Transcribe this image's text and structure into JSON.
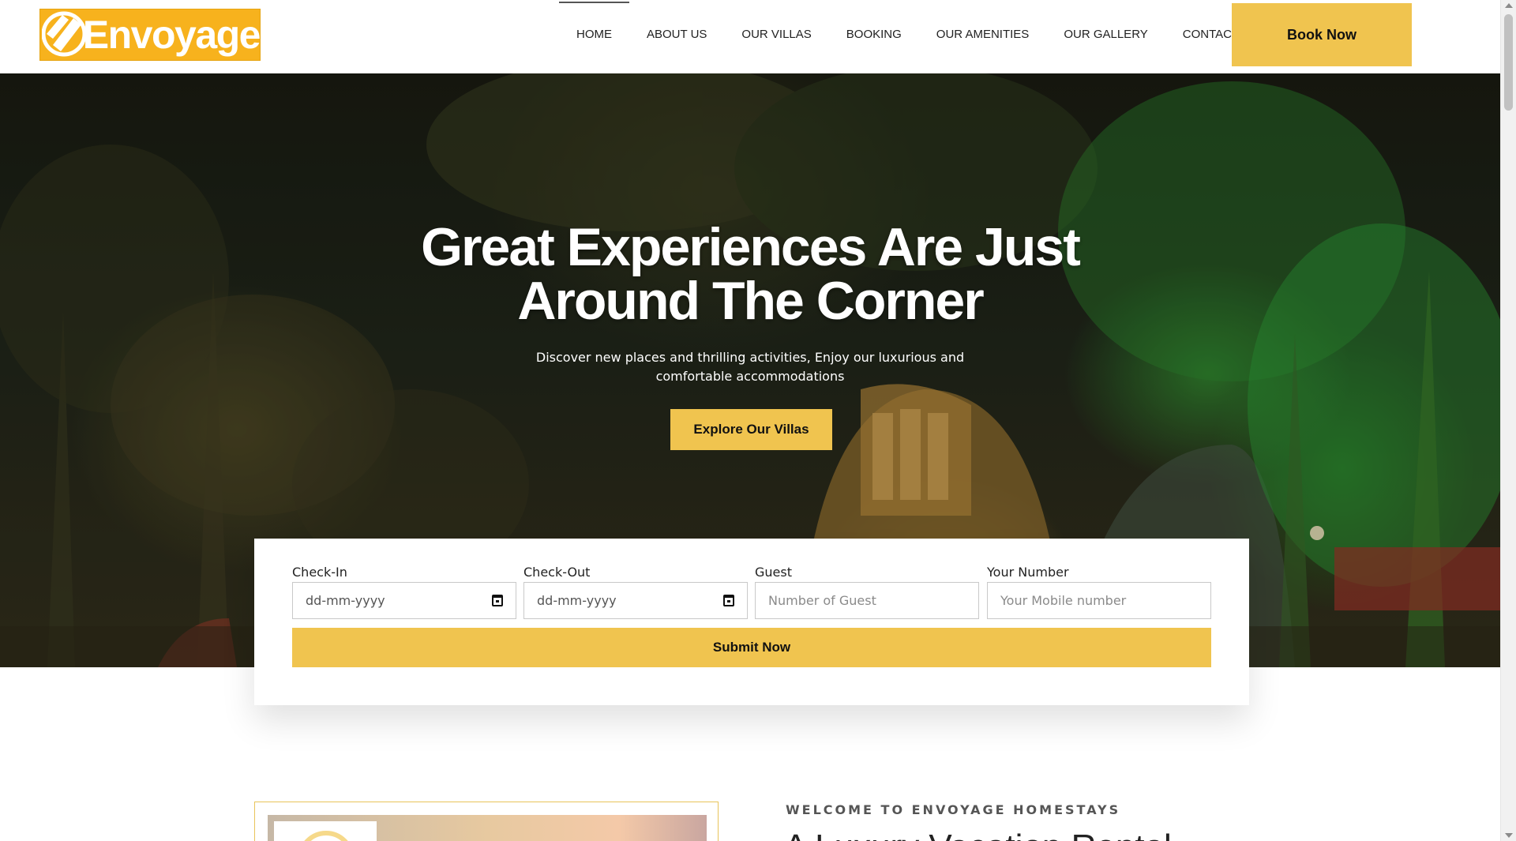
{
  "header": {
    "logo_text": "Envoyage",
    "nav": [
      {
        "label": "HOME",
        "active": true
      },
      {
        "label": "ABOUT US"
      },
      {
        "label": "OUR VILLAS"
      },
      {
        "label": "BOOKING"
      },
      {
        "label": "OUR AMENITIES"
      },
      {
        "label": "OUR GALLERY"
      },
      {
        "label": "CONTACT US"
      }
    ],
    "book_now_label": "Book Now"
  },
  "hero": {
    "title_line1": "Great Experiences Are Just",
    "title_line2": "Around The Corner",
    "subtitle": "Discover new places and thrilling activities, Enjoy our luxurious and comfortable accommodations",
    "cta_label": "Explore Our Villas"
  },
  "booking": {
    "checkin": {
      "label": "Check-In",
      "placeholder": "dd-mm-yyyy"
    },
    "checkout": {
      "label": "Check-Out",
      "placeholder": "dd-mm-yyyy"
    },
    "guest": {
      "label": "Guest",
      "placeholder": "Number of Guest"
    },
    "number": {
      "label": "Your Number",
      "placeholder": "Your Mobile number"
    },
    "submit_label": "Submit Now"
  },
  "welcome": {
    "eyebrow": "WELCOME TO ENVOYAGE HOMESTAYS",
    "heading": "A Luxury Vacation Rental"
  },
  "colors": {
    "brand_yellow": "#f7b21d",
    "button_yellow": "#f0c44f"
  },
  "icons": {
    "logo": "envoyage-logo-icon",
    "calendar": "calendar-icon"
  }
}
